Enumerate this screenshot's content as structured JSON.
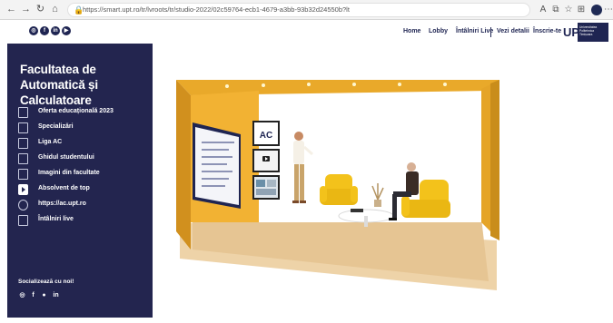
{
  "browser": {
    "url": "https://smart.upt.ro/tr/lvroots/tr/studio-2022/02c59764-ecb1-4679-a3bb-93b32d24550b?lt",
    "icons": [
      "back-icon",
      "forward-icon",
      "refresh-icon",
      "home-icon",
      "lock-icon",
      "read-aloud-icon",
      "extensions-icon",
      "favorites-icon",
      "collections-icon",
      "profile-icon",
      "more-icon"
    ]
  },
  "topnav": {
    "social_icons": [
      "instagram-icon",
      "facebook-icon",
      "linkedin-icon",
      "youtube-icon"
    ],
    "links": [
      "Home",
      "Lobby",
      "Întâlniri Live",
      "Vezi detalii",
      "Înscrie-te"
    ],
    "logo": {
      "mark": "UP",
      "text": "Universitatea Politehnica Timișoara"
    }
  },
  "sidebar": {
    "title": "Facultatea de Automatică și Calculatoare",
    "items": [
      {
        "label": "Oferta educațională 2023",
        "icon": "document-icon"
      },
      {
        "label": "Specializări",
        "icon": "document-icon"
      },
      {
        "label": "Liga AC",
        "icon": "document-icon"
      },
      {
        "label": "Ghidul studentului",
        "icon": "document-icon"
      },
      {
        "label": "Imagini din facultate",
        "icon": "image-icon"
      },
      {
        "label": "Absolvent de top",
        "icon": "play-icon"
      },
      {
        "label": "https://ac.upt.ro",
        "icon": "globe-icon"
      },
      {
        "label": "Întâlniri live",
        "icon": "building-icon"
      }
    ],
    "social_heading": "Socializează cu noi!",
    "social_icons": [
      "instagram-icon",
      "facebook-icon",
      "location-icon",
      "linkedin-icon"
    ]
  },
  "scene": {
    "screen_logo": "AC",
    "colors": {
      "wall": "#f2b233",
      "wall_dark": "#d3931f",
      "floor": "#e8c89a",
      "chair": "#f3c21b",
      "sidebar": "#23254f"
    }
  }
}
